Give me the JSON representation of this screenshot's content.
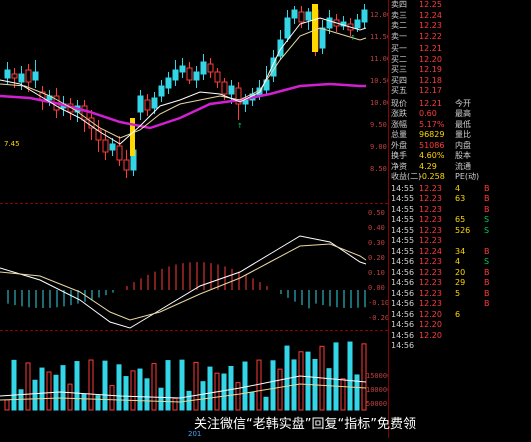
{
  "price_axis": [
    "12.00",
    "11.50",
    "11.00",
    "10.50",
    "10.00",
    "9.50",
    "9.00",
    "8.50"
  ],
  "macd_axis": [
    "0.50",
    "0.40",
    "0.30",
    "0.20",
    "0.10",
    "0.00",
    "-0.10",
    "-0.20"
  ],
  "volume_axis": [
    "150000",
    "100000",
    "50000"
  ],
  "chart_labels": {
    "upper": "7.45",
    "lower": "201"
  },
  "order_book": [
    {
      "label": "卖四",
      "price": "12.25",
      "vol": "",
      "color": "red"
    },
    {
      "label": "卖三",
      "price": "12.24",
      "vol": "",
      "color": "red"
    },
    {
      "label": "卖二",
      "price": "12.23",
      "vol": "",
      "color": "red"
    },
    {
      "label": "卖一",
      "price": "12.22",
      "vol": "",
      "color": "red"
    },
    {
      "label": "买一",
      "price": "12.21",
      "vol": "",
      "color": "red"
    },
    {
      "label": "买二",
      "price": "12.20",
      "vol": "",
      "color": "red"
    },
    {
      "label": "买三",
      "price": "12.19",
      "vol": "",
      "color": "red"
    },
    {
      "label": "买四",
      "price": "12.18",
      "vol": "",
      "color": "red"
    },
    {
      "label": "买五",
      "price": "12.17",
      "vol": "",
      "color": "red"
    }
  ],
  "stats": [
    {
      "l1": "现价",
      "v1": "12.21",
      "l2": "今开",
      "v2": "",
      "c1": "red",
      "c2": "red"
    },
    {
      "l1": "涨跌",
      "v1": "0.60",
      "l2": "最高",
      "v2": "",
      "c1": "red",
      "c2": "red"
    },
    {
      "l1": "涨幅",
      "v1": "5.17%",
      "l2": "最低",
      "v2": "",
      "c1": "red",
      "c2": "red"
    },
    {
      "l1": "总量",
      "v1": "96829",
      "l2": "量比",
      "v2": "",
      "c1": "yellow",
      "c2": "yellow"
    },
    {
      "l1": "外盘",
      "v1": "51086",
      "l2": "内盘",
      "v2": "",
      "c1": "red",
      "c2": "green"
    },
    {
      "l1": "换手",
      "v1": "4.60%",
      "l2": "股本",
      "v2": "",
      "c1": "yellow",
      "c2": "yellow"
    },
    {
      "l1": "净资",
      "v1": "4.29",
      "l2": "流通",
      "v2": "",
      "c1": "yellow",
      "c2": "yellow"
    },
    {
      "l1": "收益(二)",
      "v1": "-0.258",
      "l2": "PE(动)",
      "v2": "",
      "c1": "yellow",
      "c2": "yellow"
    }
  ],
  "trades": [
    {
      "t": "14:55",
      "p": "12.23",
      "v": "4",
      "d": "B"
    },
    {
      "t": "14:55",
      "p": "12.23",
      "v": "63",
      "d": "B"
    },
    {
      "t": "14:55",
      "p": "12.23",
      "v": "",
      "d": "B"
    },
    {
      "t": "14:55",
      "p": "12.23",
      "v": "65",
      "d": "S"
    },
    {
      "t": "14:55",
      "p": "12.23",
      "v": "526",
      "d": "S"
    },
    {
      "t": "14:55",
      "p": "12.23",
      "v": "",
      "d": ""
    },
    {
      "t": "14:55",
      "p": "12.24",
      "v": "34",
      "d": "B"
    },
    {
      "t": "14:56",
      "p": "12.23",
      "v": "4",
      "d": "S"
    },
    {
      "t": "14:56",
      "p": "12.23",
      "v": "20",
      "d": "B"
    },
    {
      "t": "14:56",
      "p": "12.23",
      "v": "29",
      "d": "B"
    },
    {
      "t": "14:56",
      "p": "12.23",
      "v": "5",
      "d": "B"
    },
    {
      "t": "14:56",
      "p": "12.23",
      "v": "",
      "d": "B"
    },
    {
      "t": "14:56",
      "p": "12.20",
      "v": "6",
      "d": ""
    },
    {
      "t": "14:56",
      "p": "12.20",
      "v": "",
      "d": ""
    },
    {
      "t": "14:56",
      "p": "12.20",
      "v": "",
      "d": ""
    },
    {
      "t": "14:56",
      "p": "",
      "v": "",
      "d": ""
    }
  ],
  "watermark": "关注微信“老韩实盘”回复“指标”免费领"
}
